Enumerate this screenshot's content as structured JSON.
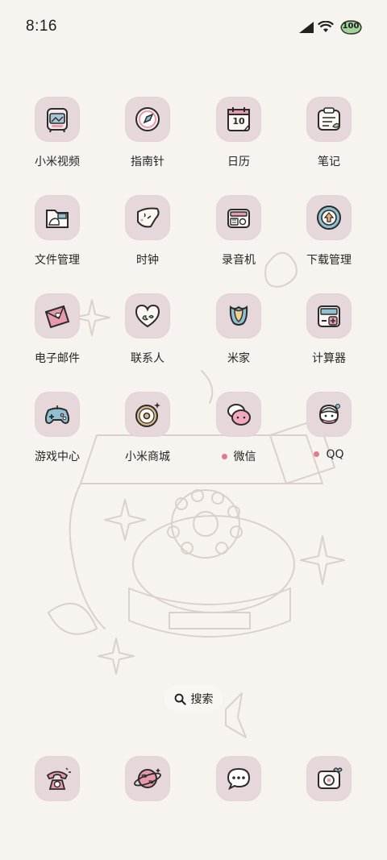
{
  "status_bar": {
    "time": "8:16",
    "battery": "100",
    "icons": [
      "signal-icon",
      "wifi-icon",
      "battery-icon"
    ]
  },
  "apps": [
    {
      "label": "小米视频",
      "icon": "tv-icon",
      "notification": false
    },
    {
      "label": "指南针",
      "icon": "compass-icon",
      "notification": false
    },
    {
      "label": "日历",
      "icon": "calendar-icon",
      "notification": false,
      "day": "10"
    },
    {
      "label": "笔记",
      "icon": "notes-icon",
      "notification": false
    },
    {
      "label": "文件管理",
      "icon": "folder-icon",
      "notification": false
    },
    {
      "label": "时钟",
      "icon": "clock-icon",
      "notification": false
    },
    {
      "label": "录音机",
      "icon": "radio-icon",
      "notification": false
    },
    {
      "label": "下载管理",
      "icon": "download-icon",
      "notification": false
    },
    {
      "label": "电子邮件",
      "icon": "mail-icon",
      "notification": false
    },
    {
      "label": "联系人",
      "icon": "heart-contacts-icon",
      "notification": false
    },
    {
      "label": "米家",
      "icon": "tulip-icon",
      "notification": false
    },
    {
      "label": "计算器",
      "icon": "calculator-icon",
      "notification": false
    },
    {
      "label": "游戏中心",
      "icon": "gamepad-icon",
      "notification": false
    },
    {
      "label": "小米商城",
      "icon": "donut-icon",
      "notification": false
    },
    {
      "label": "微信",
      "icon": "chat-bubbles-icon",
      "notification": true
    },
    {
      "label": "QQ",
      "icon": "penguin-icon",
      "notification": true
    }
  ],
  "search": {
    "label": "搜索"
  },
  "dock": [
    {
      "icon": "phone-icon"
    },
    {
      "icon": "planet-icon"
    },
    {
      "icon": "message-icon"
    },
    {
      "icon": "camera-icon"
    }
  ],
  "colors": {
    "tile": "#e6d8da",
    "background": "#f7f3ee",
    "notification_dot": "#e07a92"
  }
}
